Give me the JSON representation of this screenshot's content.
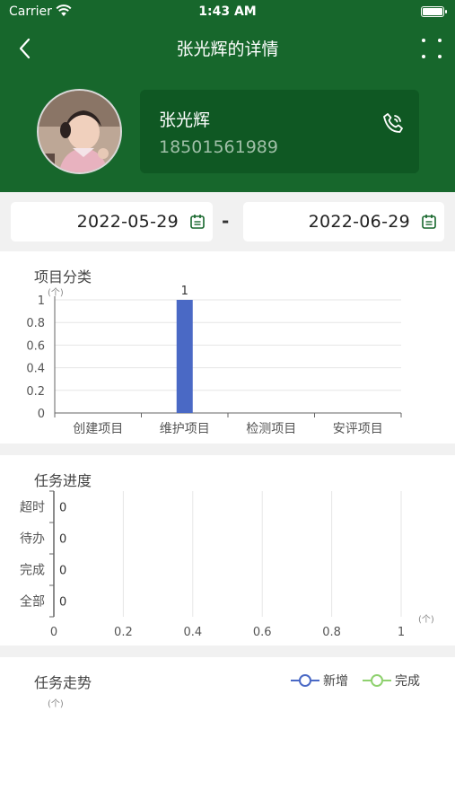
{
  "status_bar": {
    "carrier": "Carrier",
    "time": "1:43 AM"
  },
  "nav": {
    "title": "张光辉的详情"
  },
  "profile": {
    "name": "张光辉",
    "phone": "18501561989"
  },
  "date_range": {
    "start": "2022-05-29",
    "end": "2022-06-29",
    "separator": "-"
  },
  "project_chart": {
    "title": "项目分类",
    "unit": "(个)",
    "chart_data": {
      "type": "bar",
      "categories": [
        "创建项目",
        "维护项目",
        "检测项目",
        "安评项目"
      ],
      "values": [
        0,
        1,
        0,
        0
      ],
      "data_labels": [
        "",
        "1",
        "",
        ""
      ],
      "yticks": [
        "0",
        "0.2",
        "0.4",
        "0.6",
        "0.8",
        "1"
      ],
      "ylim": [
        0,
        1
      ],
      "bar_color": "#4a69c5",
      "grid": true
    }
  },
  "task_chart": {
    "title": "任务进度",
    "unit": "(个)",
    "chart_data": {
      "type": "bar",
      "orientation": "horizontal",
      "categories": [
        "超时",
        "待办",
        "完成",
        "全部"
      ],
      "values": [
        0,
        0,
        0,
        0
      ],
      "data_labels": [
        "0",
        "0",
        "0",
        "0"
      ],
      "xticks": [
        "0",
        "0.2",
        "0.4",
        "0.6",
        "0.8",
        "1"
      ],
      "xlim": [
        0,
        1
      ],
      "grid": true
    }
  },
  "trend_chart": {
    "title": "任务走势",
    "unit": "(个)",
    "legend": [
      {
        "label": "新增",
        "color": "#4a69c5"
      },
      {
        "label": "完成",
        "color": "#8fd16f"
      }
    ]
  },
  "colors": {
    "brand": "#17672c",
    "card": "#0f5823",
    "accent": "#17672c"
  }
}
